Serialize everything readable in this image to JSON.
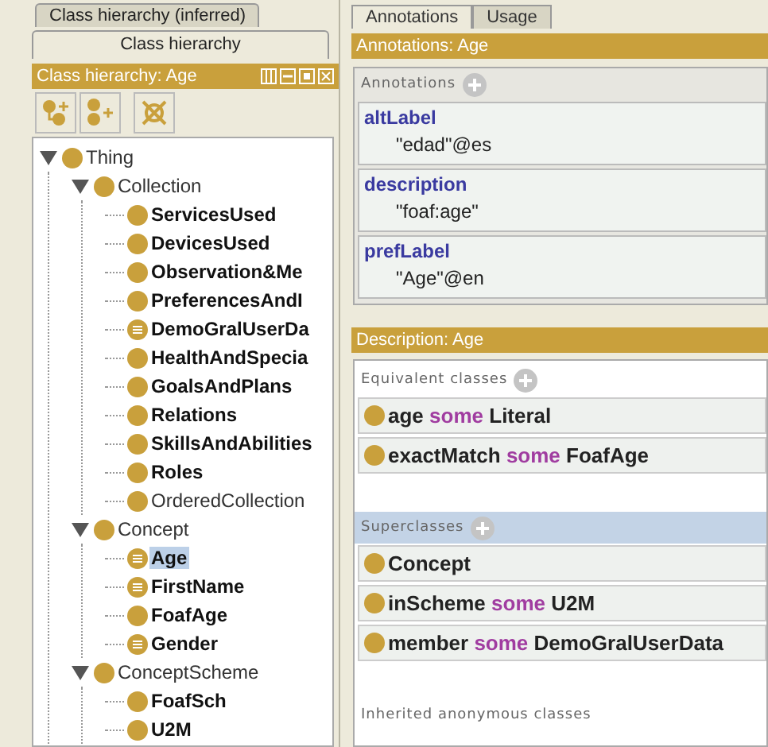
{
  "class_hierarchy": {
    "tabs": [
      {
        "label": "Class hierarchy (inferred)",
        "selected": false
      },
      {
        "label": "Class hierarchy",
        "selected": true
      }
    ],
    "title": "Class hierarchy: Age",
    "tree": [
      {
        "label": "Thing",
        "kind": "primitive",
        "bold": false,
        "selected": false,
        "expanded": true,
        "children": [
          {
            "label": "Collection",
            "kind": "primitive",
            "bold": false,
            "selected": false,
            "expanded": true,
            "children": [
              {
                "label": "ServicesUsed",
                "kind": "primitive",
                "bold": true,
                "selected": false
              },
              {
                "label": "DevicesUsed",
                "kind": "primitive",
                "bold": true,
                "selected": false
              },
              {
                "label": "Observation&Me",
                "kind": "primitive",
                "bold": true,
                "selected": false
              },
              {
                "label": "PreferencesAndI",
                "kind": "primitive",
                "bold": true,
                "selected": false
              },
              {
                "label": "DemoGralUserDa",
                "kind": "defined",
                "bold": true,
                "selected": false
              },
              {
                "label": "HealthAndSpecia",
                "kind": "primitive",
                "bold": true,
                "selected": false
              },
              {
                "label": "GoalsAndPlans",
                "kind": "primitive",
                "bold": true,
                "selected": false
              },
              {
                "label": "Relations",
                "kind": "primitive",
                "bold": true,
                "selected": false
              },
              {
                "label": "SkillsAndAbilities",
                "kind": "primitive",
                "bold": true,
                "selected": false
              },
              {
                "label": "Roles",
                "kind": "primitive",
                "bold": true,
                "selected": false
              },
              {
                "label": "OrderedCollection",
                "kind": "primitive",
                "bold": false,
                "selected": false
              }
            ]
          },
          {
            "label": "Concept",
            "kind": "primitive",
            "bold": false,
            "selected": false,
            "expanded": true,
            "children": [
              {
                "label": "Age",
                "kind": "defined",
                "bold": true,
                "selected": true
              },
              {
                "label": "FirstName",
                "kind": "defined",
                "bold": true,
                "selected": false
              },
              {
                "label": "FoafAge",
                "kind": "primitive",
                "bold": true,
                "selected": false
              },
              {
                "label": "Gender",
                "kind": "defined",
                "bold": true,
                "selected": false
              }
            ]
          },
          {
            "label": "ConceptScheme",
            "kind": "primitive",
            "bold": false,
            "selected": false,
            "expanded": true,
            "children": [
              {
                "label": "FoafSch",
                "kind": "primitive",
                "bold": true,
                "selected": false
              },
              {
                "label": "U2M",
                "kind": "primitive",
                "bold": true,
                "selected": false
              }
            ]
          }
        ]
      }
    ]
  },
  "tabs": [
    {
      "label": "Annotations",
      "selected": true
    },
    {
      "label": "Usage",
      "selected": false
    }
  ],
  "annotations": {
    "title": "Annotations: Age",
    "header": "Annotations",
    "items": [
      {
        "property": "altLabel",
        "value": "\"edad\"@es"
      },
      {
        "property": "description",
        "value": "\"foaf:age\""
      },
      {
        "property": "prefLabel",
        "value": "\"Age\"@en"
      }
    ]
  },
  "description": {
    "title": "Description: Age",
    "sections": [
      {
        "header": "Equivalent classes",
        "highlighted": false,
        "add_button": true,
        "rows": [
          {
            "segments": [
              {
                "text": "age",
                "kind": "entity"
              },
              {
                "text": "some",
                "kind": "keyword"
              },
              {
                "text": "Literal",
                "kind": "entity"
              }
            ]
          },
          {
            "segments": [
              {
                "text": "exactMatch",
                "kind": "entity"
              },
              {
                "text": "some",
                "kind": "keyword"
              },
              {
                "text": "FoafAge",
                "kind": "entity"
              }
            ]
          }
        ]
      },
      {
        "header": "Superclasses",
        "highlighted": true,
        "add_button": true,
        "rows": [
          {
            "segments": [
              {
                "text": "Concept",
                "kind": "entity"
              }
            ]
          },
          {
            "segments": [
              {
                "text": "inScheme",
                "kind": "entity"
              },
              {
                "text": "some",
                "kind": "keyword"
              },
              {
                "text": "U2M",
                "kind": "entity"
              }
            ]
          },
          {
            "segments": [
              {
                "text": "member",
                "kind": "entity"
              },
              {
                "text": "some",
                "kind": "keyword"
              },
              {
                "text": "DemoGralUserData",
                "kind": "entity"
              }
            ]
          }
        ]
      },
      {
        "header": "Inherited anonymous classes",
        "highlighted": false,
        "add_button": false
      }
    ]
  }
}
